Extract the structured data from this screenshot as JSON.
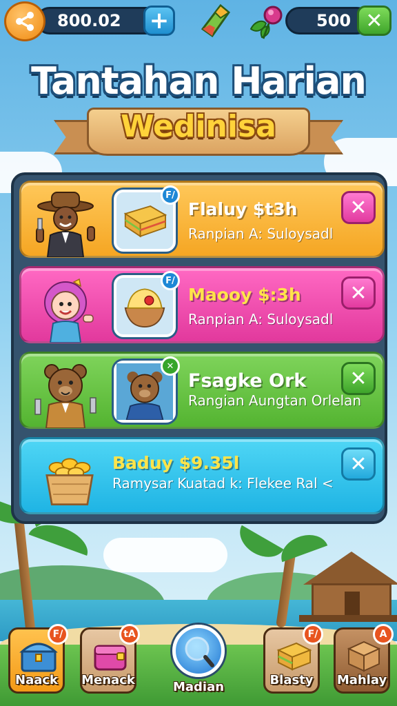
{
  "topbar": {
    "coins": "800.02",
    "plus_label": "+",
    "gems": "500",
    "close_label": "✕"
  },
  "header": {
    "title": "Tantahan Harian",
    "subtitle": "Wedinisa"
  },
  "quests": [
    {
      "title": "Flaluy $t3h",
      "description": "Ranpian A: Suloysadl",
      "color": "orange",
      "item_badge": "F/",
      "close": "✕"
    },
    {
      "title": "Maooy $:3h",
      "description": "Ranpian A: Suloysadl",
      "color": "pink",
      "item_badge": "F/",
      "close": "✕"
    },
    {
      "title": "Fsagke Ork",
      "description": "Rangian Aungtan Orlelan",
      "color": "green",
      "item_badge": "✕",
      "close": "✕"
    },
    {
      "title": "Baduy $9.35l",
      "description": "Ramysar Kuatad k: Flekee Ral <",
      "color": "blue",
      "close": "✕"
    }
  ],
  "nav": [
    {
      "label": "Naack",
      "badge": "F/"
    },
    {
      "label": "Menack",
      "badge": "tA"
    },
    {
      "label": "Madian"
    },
    {
      "label": "Blasty",
      "badge": "F/"
    },
    {
      "label": "Mahlay",
      "badge": "A"
    }
  ],
  "colors": {
    "orange_card": "#f5a623",
    "pink_card": "#e2399d",
    "green_card": "#54b431",
    "blue_card": "#1fb4e4",
    "panel": "#35536e"
  }
}
